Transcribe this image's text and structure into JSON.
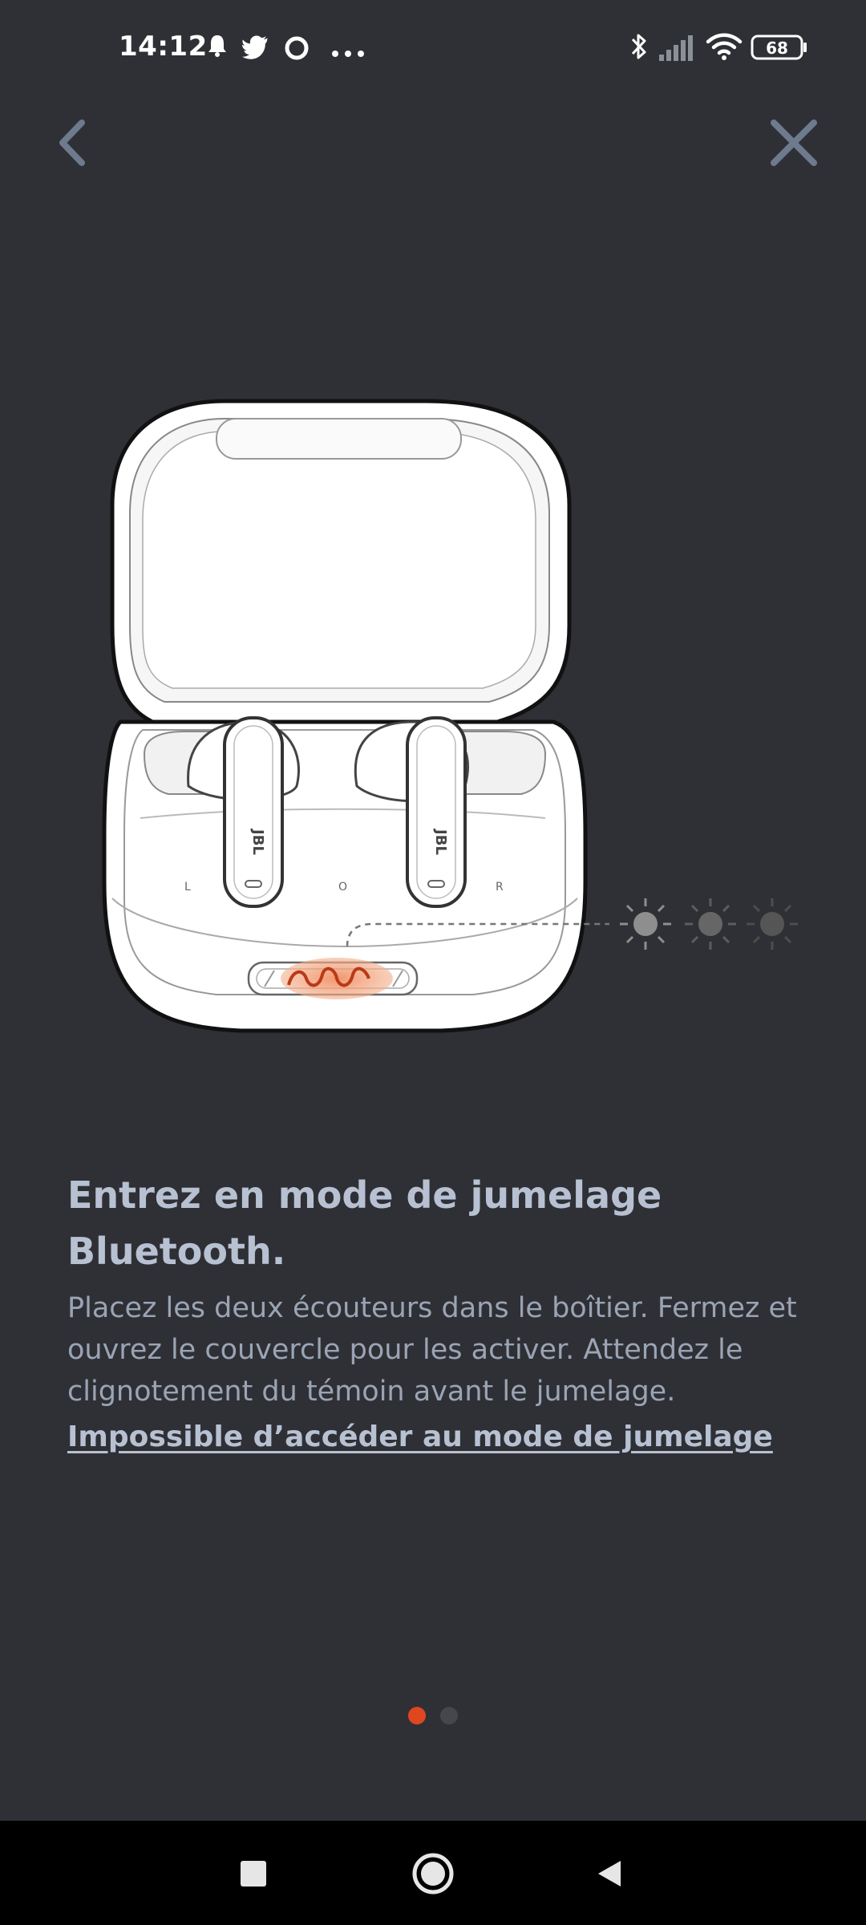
{
  "status_bar": {
    "time": "14:12",
    "battery_level": "68",
    "icons": [
      "notification-bell-icon",
      "twitter-icon",
      "circle-app-icon",
      "more-dots-icon",
      "bluetooth-icon",
      "cell-signal-icon",
      "wifi-icon",
      "battery-icon"
    ]
  },
  "nav": {
    "back_icon": "chevron-left-icon",
    "close_icon": "close-icon"
  },
  "illustration": {
    "case_labels": {
      "left": "L",
      "center": "O",
      "right": "R"
    },
    "bud_brand": "JBL",
    "indicator_lights": 3
  },
  "content": {
    "title": "Entrez en mode de jumelage Bluetooth.",
    "description": "Placez les deux écouteurs dans le boîtier. Fermez et ouvrez le couvercle pour les activer. Attendez le clignotement du témoin avant le jumelage.",
    "help_link": "Impossible d’accéder au mode de jumelage"
  },
  "pager": {
    "total": 2,
    "active_index": 0
  },
  "colors": {
    "background": "#2f3035",
    "accent": "#e0461f",
    "title_text": "#b7c1d2",
    "body_text": "#9aa4b5",
    "inactive_dot": "#45474d",
    "nav_icon": "#6e7a8e"
  }
}
